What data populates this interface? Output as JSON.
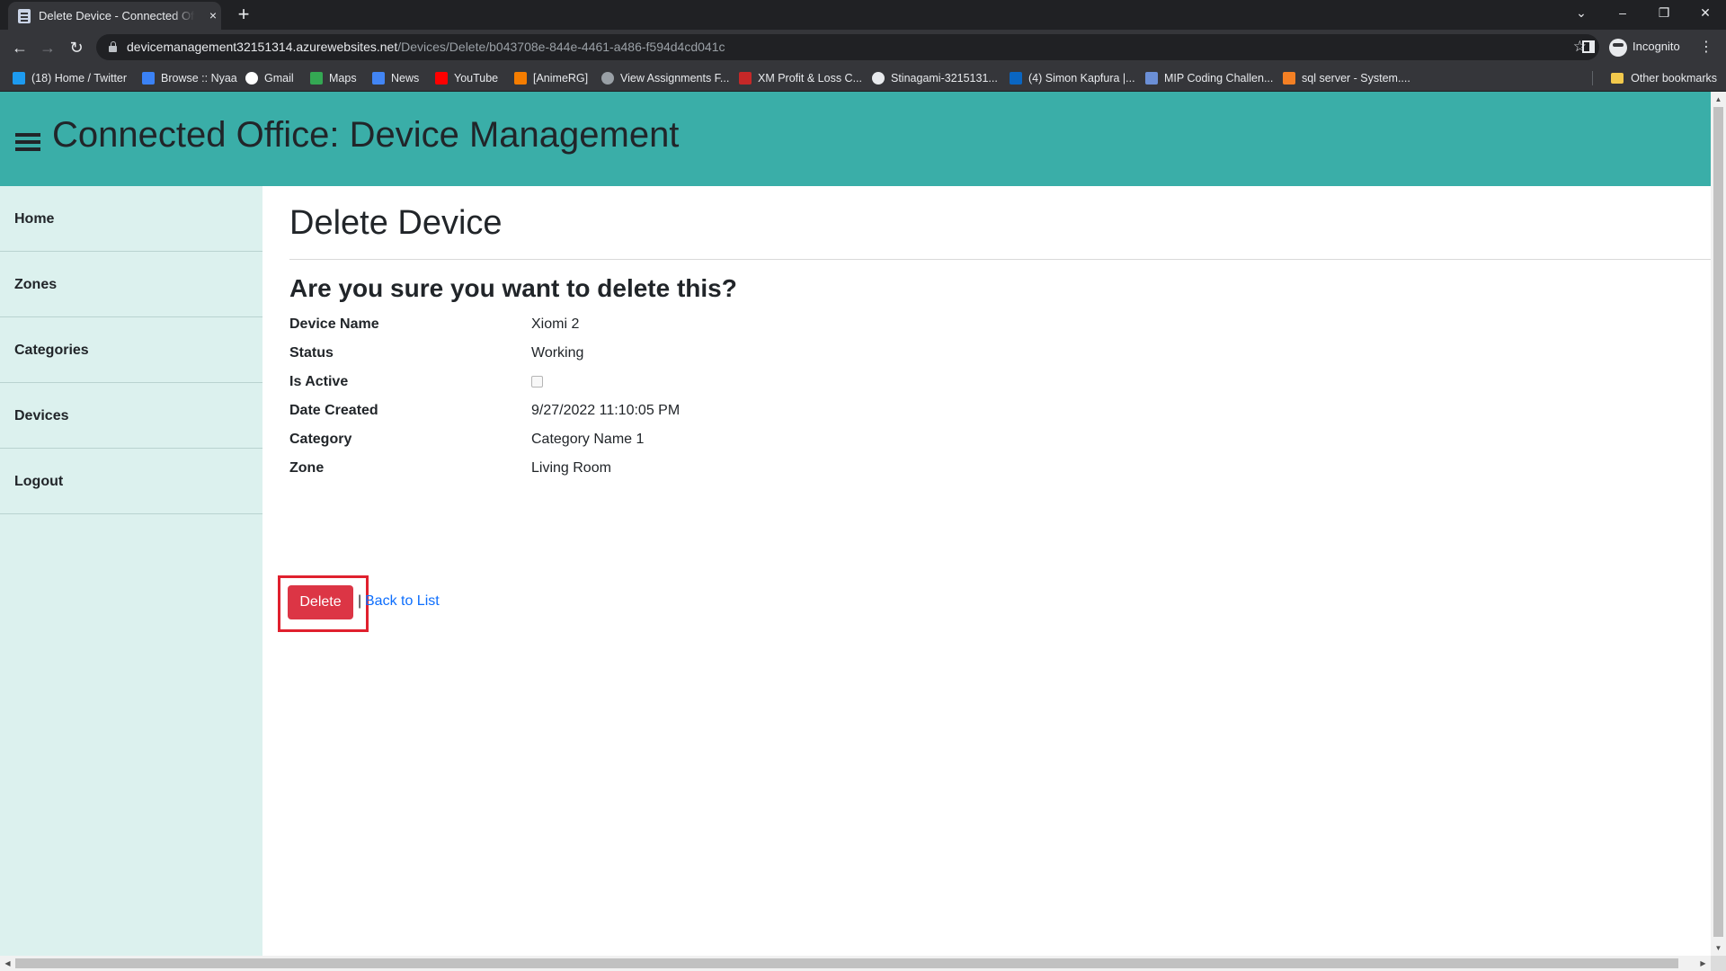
{
  "browser": {
    "tab_title": "Delete Device - Connected Office: Device Management",
    "tab_close": "×",
    "new_tab": "+",
    "window_controls": {
      "tab_search": "⌄",
      "minimize": "–",
      "restore": "❐",
      "close": "✕"
    },
    "nav": {
      "back": "←",
      "forward": "→",
      "reload": "↻"
    },
    "url_host": "devicemanagement32151314.azurewebsites.net",
    "url_path": "/Devices/Delete/b043708e-844e-4461-a486-f594d4cd041c",
    "star": "☆",
    "profile_label": "Incognito",
    "menu": "⋮"
  },
  "bookmarks": [
    {
      "label": "(18) Home / Twitter",
      "icon": "twitter-icon",
      "color": "#1d9bf0"
    },
    {
      "label": "Browse :: Nyaa",
      "icon": "nyaa-icon",
      "color": "#3b82f6"
    },
    {
      "label": "Gmail",
      "icon": "google-icon",
      "color": "#ffffff"
    },
    {
      "label": "Maps",
      "icon": "maps-icon",
      "color": "#34a853"
    },
    {
      "label": "News",
      "icon": "news-icon",
      "color": "#4285f4"
    },
    {
      "label": "YouTube",
      "icon": "youtube-icon",
      "color": "#ff0000"
    },
    {
      "label": "[AnimeRG]",
      "icon": "blogger-icon",
      "color": "#f57d00"
    },
    {
      "label": "View Assignments F...",
      "icon": "globe-icon",
      "color": "#9aa0a6"
    },
    {
      "label": "XM Profit & Loss C...",
      "icon": "xm-icon",
      "color": "#c62828"
    },
    {
      "label": "Stinagami-3215131...",
      "icon": "github-icon",
      "color": "#e8eaed"
    },
    {
      "label": "(4) Simon Kapfura |...",
      "icon": "linkedin-icon",
      "color": "#0a66c2"
    },
    {
      "label": "MIP Coding Challen...",
      "icon": "mip-icon",
      "color": "#6b8fd6"
    },
    {
      "label": "sql server - System....",
      "icon": "stackoverflow-icon",
      "color": "#f48024"
    }
  ],
  "other_bookmarks": "Other bookmarks",
  "app": {
    "title": "Connected Office: Device Management",
    "header_color": "#3aaea8",
    "sidebar_color": "#dcf1ee"
  },
  "sidebar": {
    "items": [
      {
        "label": "Home"
      },
      {
        "label": "Zones"
      },
      {
        "label": "Categories"
      },
      {
        "label": "Devices"
      },
      {
        "label": "Logout"
      }
    ]
  },
  "page": {
    "title": "Delete Device",
    "question": "Are you sure you want to delete this?",
    "fields": [
      {
        "label": "Device Name",
        "value": "Xiomi 2"
      },
      {
        "label": "Status",
        "value": "Working"
      },
      {
        "label": "Is Active",
        "value": "",
        "checked": false
      },
      {
        "label": "Date Created",
        "value": "9/27/2022 11:10:05 PM"
      },
      {
        "label": "Category",
        "value": "Category Name 1"
      },
      {
        "label": "Zone",
        "value": "Living Room"
      }
    ],
    "delete_label": "Delete",
    "separator": "|",
    "back_label": "Back to List",
    "delete_color": "#dc3545",
    "highlight_color": "#e0202e"
  }
}
